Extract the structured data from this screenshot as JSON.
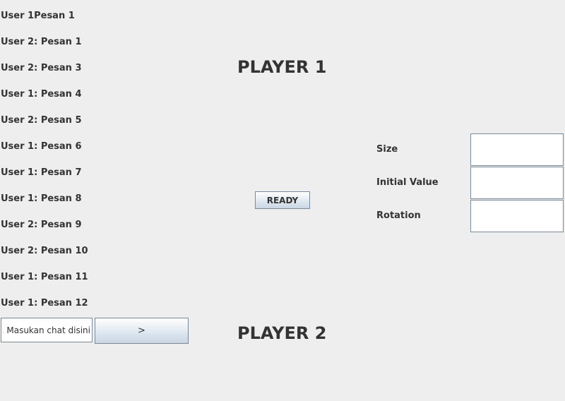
{
  "chat": {
    "messages": [
      "User 1Pesan 1",
      "User 2: Pesan 1",
      "User 2: Pesan 3",
      "User 1: Pesan 4",
      "User 2: Pesan 5",
      "User 1: Pesan 6",
      "User 1: Pesan 7",
      "User 1: Pesan 8",
      "User 2: Pesan 9",
      "User 2: Pesan 10",
      "User 1: Pesan 11",
      "User 1: Pesan 12"
    ],
    "input_value": "Masukan chat disini ..",
    "send_label": ">"
  },
  "players": {
    "player1_label": "PLAYER 1",
    "player2_label": "PLAYER 2"
  },
  "ready_label": "READY",
  "params": {
    "size_label": "Size",
    "size_value": "",
    "initial_value_label": "Initial Value",
    "initial_value_value": "",
    "rotation_label": "Rotation",
    "rotation_value": ""
  }
}
